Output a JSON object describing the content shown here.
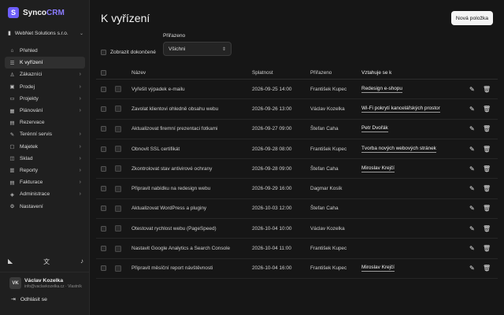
{
  "app": {
    "brand_first": "Synco",
    "brand_accent": "CRM",
    "logo_letter": "S",
    "workspace": "WebNet Solutions s.r.o."
  },
  "sidebar": {
    "items": [
      {
        "label": "Přehled",
        "icon": "home-icon",
        "glyph": "⌂",
        "chevron": false,
        "active": false
      },
      {
        "label": "K vyřízení",
        "icon": "checklist-icon",
        "glyph": "☰",
        "chevron": false,
        "active": true
      },
      {
        "label": "Zákazníci",
        "icon": "users-icon",
        "glyph": "♙",
        "chevron": true,
        "active": false
      },
      {
        "label": "Prodej",
        "icon": "cart-icon",
        "glyph": "▣",
        "chevron": true,
        "active": false
      },
      {
        "label": "Projekty",
        "icon": "folder-icon",
        "glyph": "▭",
        "chevron": true,
        "active": false
      },
      {
        "label": "Plánování",
        "icon": "calendar-icon",
        "glyph": "▦",
        "chevron": true,
        "active": false
      },
      {
        "label": "Rezervace",
        "icon": "booking-icon",
        "glyph": "▤",
        "chevron": false,
        "active": false
      },
      {
        "label": "Terénní servis",
        "icon": "wrench-icon",
        "glyph": "✎",
        "chevron": true,
        "active": false
      },
      {
        "label": "Majetek",
        "icon": "briefcase-icon",
        "glyph": "▢",
        "chevron": true,
        "active": false
      },
      {
        "label": "Sklad",
        "icon": "box-icon",
        "glyph": "◫",
        "chevron": true,
        "active": false
      },
      {
        "label": "Reporty",
        "icon": "chart-icon",
        "glyph": "▥",
        "chevron": true,
        "active": false
      },
      {
        "label": "Fakturace",
        "icon": "invoice-icon",
        "glyph": "▤",
        "chevron": true,
        "active": false
      },
      {
        "label": "Administrace",
        "icon": "admin-icon",
        "glyph": "◈",
        "chevron": true,
        "active": false
      },
      {
        "label": "Nastavení",
        "icon": "gear-icon",
        "glyph": "⚙",
        "chevron": false,
        "active": false
      }
    ],
    "tools": {
      "logo_glyph": "◣",
      "translate_glyph": "文",
      "bell_glyph": "♪"
    },
    "user": {
      "initials": "VK",
      "name": "Václav Kozelka",
      "email": "info@vaclavkozelka.cz · Vlastník"
    },
    "logout_label": "Odhlásit se"
  },
  "main": {
    "title": "K vyřízení",
    "new_button": "Nová položka",
    "show_completed_label": "Zobrazit dokončené",
    "filter_label": "Přiřazeno",
    "filter_value": "Všichni"
  },
  "table": {
    "columns": {
      "name": "Název",
      "due": "Splatnost",
      "assigned": "Přiřazeno",
      "related": "Vztahuje se k"
    },
    "rows": [
      {
        "name": "Vyřešit výpadek e-mailu",
        "due": "2026-09-25 14:00",
        "assigned": "František Kupec",
        "related": "Redesign e-shopu"
      },
      {
        "name": "Zavolat klientovi ohledně obsahu webu",
        "due": "2026-09-26 13:00",
        "assigned": "Václav Kozelka",
        "related": "Wi-Fi pokrytí kancelářských prostor"
      },
      {
        "name": "Aktualizovat firemní prezentaci fotkami",
        "due": "2026-09-27 09:00",
        "assigned": "Štefan Caha",
        "related": "Petr Dvořák"
      },
      {
        "name": "Obnovit SSL certifikát",
        "due": "2026-09-28 08:00",
        "assigned": "František Kupec",
        "related": "Tvorba nových webových stránek"
      },
      {
        "name": "Zkontrolovat stav antivirové ochrany",
        "due": "2026-09-28 09:00",
        "assigned": "Štefan Caha",
        "related": "Miroslav Krejčí"
      },
      {
        "name": "Připravit nabídku na redesign webu",
        "due": "2026-09-29 16:00",
        "assigned": "Dagmar Kosík",
        "related": ""
      },
      {
        "name": "Aktualizovat WordPress a pluginy",
        "due": "2026-10-03 12:00",
        "assigned": "Štefan Caha",
        "related": ""
      },
      {
        "name": "Otestovat rychlost webu (PageSpeed)",
        "due": "2026-10-04 10:00",
        "assigned": "Václav Kozelka",
        "related": ""
      },
      {
        "name": "Nastavit Google Analytics a Search Console",
        "due": "2026-10-04 11:00",
        "assigned": "František Kupec",
        "related": ""
      },
      {
        "name": "Připravit měsíční report návštěvnosti",
        "due": "2026-10-04 16:00",
        "assigned": "František Kupec",
        "related": "Miroslav Krejčí"
      }
    ],
    "edit_glyph": "✎",
    "delete_glyph": "🗑"
  },
  "colors": {
    "accent": "#6d5efc",
    "background": "#161616",
    "sidebar": "#1f1f1f"
  }
}
